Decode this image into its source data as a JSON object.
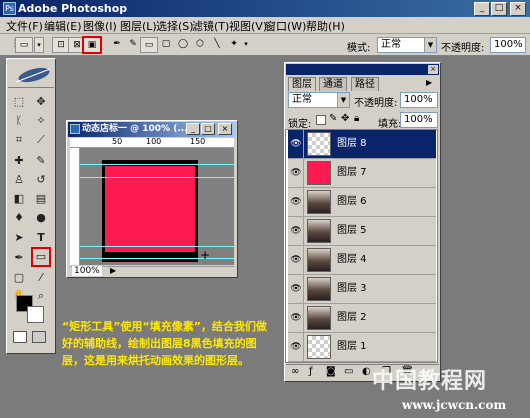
{
  "app": {
    "title": "Adobe Photoshop",
    "logo_text": "Ps",
    "controls": [
      "_",
      "□",
      "×"
    ]
  },
  "menu": [
    "文件(F)",
    "编辑(E)",
    "图像(I)",
    "图层(L)",
    "选择(S)",
    "滤镜(T)",
    "视图(V)",
    "窗口(W)",
    "帮助(H)"
  ],
  "options": {
    "mode_label": "模式:",
    "mode_value": "正常",
    "opacity_label": "不透明度:",
    "opacity_value": "100%"
  },
  "document": {
    "title": "动态店标一 @ 100% (...",
    "zoom": "100%",
    "ruler_ticks": [
      "50",
      "100",
      "150"
    ],
    "fill_color": "#ff1a52"
  },
  "layers_panel": {
    "tabs": [
      "图层",
      "通道",
      "路径"
    ],
    "blend_mode": "正常",
    "opacity_label": "不透明度:",
    "opacity_value": "100%",
    "lock_label": "锁定:",
    "fill_label": "填充:",
    "fill_value": "100%",
    "layers": [
      {
        "name": "图层 8",
        "active": true,
        "thumb": "checker"
      },
      {
        "name": "图层 7",
        "active": false,
        "thumb": "red"
      },
      {
        "name": "图层 6",
        "active": false,
        "thumb": "photo"
      },
      {
        "name": "图层 5",
        "active": false,
        "thumb": "photo"
      },
      {
        "name": "图层 4",
        "active": false,
        "thumb": "photo"
      },
      {
        "name": "图层 3",
        "active": false,
        "thumb": "photo"
      },
      {
        "name": "图层 2",
        "active": false,
        "thumb": "photo"
      },
      {
        "name": "图层 1",
        "active": false,
        "thumb": "checker"
      }
    ],
    "footer_icons": [
      "link-icon",
      "style-icon",
      "mask-icon",
      "folder-icon",
      "adjust-icon",
      "new-layer-icon",
      "trash-icon"
    ]
  },
  "caption": "“矩形工具”使用“填充像素”，结合我们做好的辅助线，绘制出图层8黑色填充的图层，这是用来烘托动画效果的图形层。",
  "watermark": {
    "main": "中国教程网",
    "url": "www.jcwcn.com"
  },
  "colors": {
    "accent": "#0a246a",
    "highlight": "#e00000",
    "caption": "#ffe800",
    "fill": "#ff1a52"
  }
}
